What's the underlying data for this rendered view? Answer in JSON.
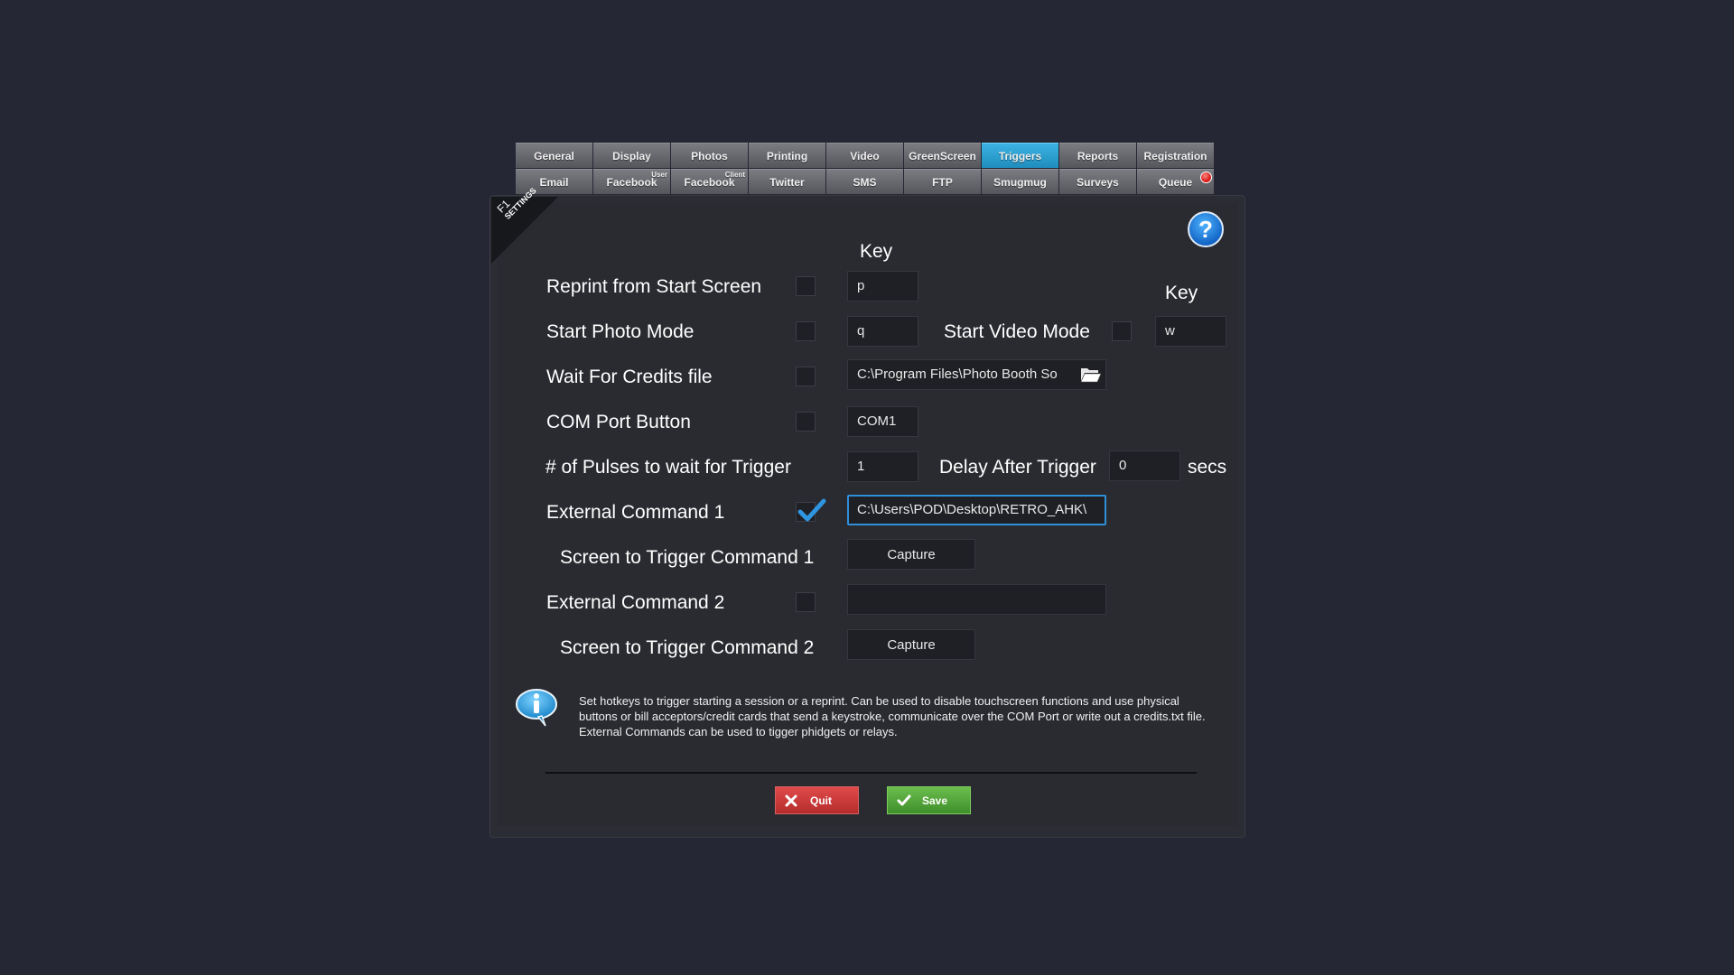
{
  "tabs": {
    "row1": [
      "General",
      "Display",
      "Photos",
      "Printing",
      "Video",
      "GreenScreen",
      "Triggers",
      "Reports",
      "Registration"
    ],
    "row2": [
      "Email",
      "Facebook",
      "Facebook",
      "Twitter",
      "SMS",
      "FTP",
      "Smugmug",
      "Surveys",
      "Queue"
    ],
    "facebook_user_tag": "User",
    "facebook_client_tag": "Client",
    "active": "Triggers"
  },
  "ribbon": {
    "line1": "F1",
    "line2": "SETTINGS"
  },
  "help": {
    "label": "?"
  },
  "key_header_1": "Key",
  "key_header_2": "Key",
  "rows": {
    "reprint": {
      "label": "Reprint from Start Screen",
      "checked": false,
      "key": "p"
    },
    "photo_mode": {
      "label": "Start Photo Mode",
      "checked": false,
      "key": "q"
    },
    "video_mode": {
      "label": "Start Video Mode",
      "checked": false,
      "key": "w"
    },
    "credits": {
      "label": "Wait For Credits file",
      "checked": false,
      "path": "C:\\Program Files\\Photo Booth So"
    },
    "com_port": {
      "label": "COM Port Button",
      "checked": false,
      "value": "COM1"
    },
    "pulses": {
      "label": "# of Pulses to wait for Trigger",
      "value": "1"
    },
    "delay": {
      "label": "Delay After Trigger",
      "value": "0",
      "unit": "secs"
    },
    "ext_cmd_1": {
      "label": "External Command 1",
      "checked": true,
      "value": "C:\\Users\\POD\\Desktop\\RETRO_AHK\\"
    },
    "screen_cmd_1": {
      "label": "Screen to Trigger Command 1",
      "button": "Capture"
    },
    "ext_cmd_2": {
      "label": "External Command 2",
      "checked": false,
      "value": ""
    },
    "screen_cmd_2": {
      "label": "Screen to Trigger Command 2",
      "button": "Capture"
    }
  },
  "info": {
    "icon": "info-speech-bubble-icon",
    "text": "Set hotkeys to trigger starting a session or a reprint.  Can be used to disable touchscreen functions and use physical buttons or bill acceptors/credit cards that send a keystroke, communicate over the COM Port or write out a credits.txt file. External Commands can be used to tigger phidgets or relays."
  },
  "buttons": {
    "quit": "Quit",
    "save": "Save"
  },
  "colors": {
    "background": "#252734",
    "active_tab": "#2aa3d6",
    "quit": "#c93a3a",
    "save": "#55a83a",
    "focus_border": "#2f8fd8"
  }
}
